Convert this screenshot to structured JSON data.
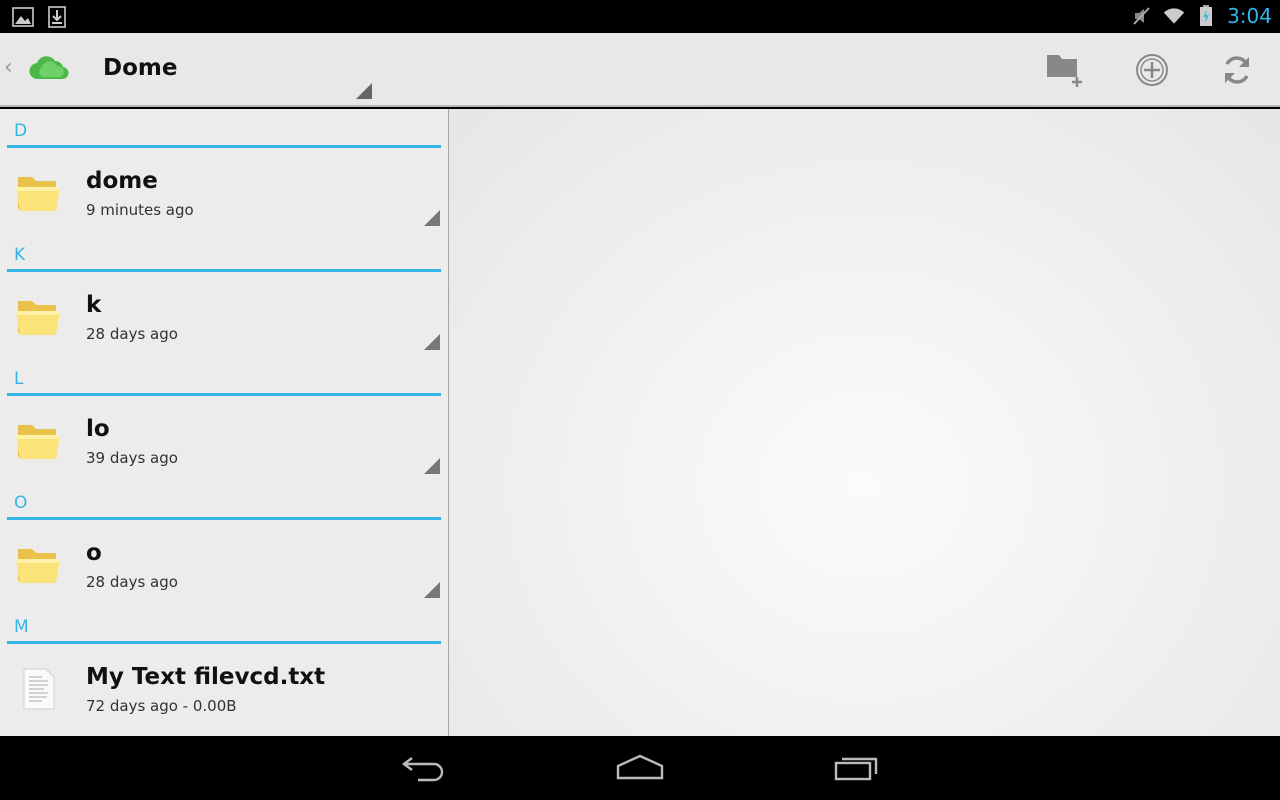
{
  "status_bar": {
    "left_icons": [
      "gallery-notification-icon",
      "download-notification-icon"
    ],
    "right_icons": [
      "muted-icon",
      "wifi-icon",
      "battery-charging-icon"
    ],
    "time": "3:04"
  },
  "action_bar": {
    "app_icon": "cloud-icon",
    "title": "Dome",
    "actions": [
      {
        "name": "new-folder-button",
        "icon": "folder-add-icon"
      },
      {
        "name": "add-button",
        "icon": "plus-circle-icon"
      },
      {
        "name": "refresh-button",
        "icon": "refresh-icon"
      }
    ]
  },
  "sections": [
    {
      "letter": "D",
      "items": [
        {
          "name": "dome",
          "meta": "9 minutes ago",
          "type": "folder"
        }
      ]
    },
    {
      "letter": "K",
      "items": [
        {
          "name": "k",
          "meta": "28 days ago",
          "type": "folder"
        }
      ]
    },
    {
      "letter": "L",
      "items": [
        {
          "name": "lo",
          "meta": "39 days ago",
          "type": "folder"
        }
      ]
    },
    {
      "letter": "O",
      "items": [
        {
          "name": "o",
          "meta": "28 days ago",
          "type": "folder"
        }
      ]
    },
    {
      "letter": "M",
      "items": [
        {
          "name": "My Text filevcd.txt",
          "meta": "72 days ago - 0.00B",
          "type": "file"
        }
      ]
    }
  ],
  "nav_bar": {
    "buttons": [
      "back-icon",
      "home-icon",
      "recent-apps-icon"
    ]
  },
  "colors": {
    "accent": "#33b5e5",
    "action_bar_bg": "#e8e8e8",
    "list_bg": "#ececec"
  }
}
